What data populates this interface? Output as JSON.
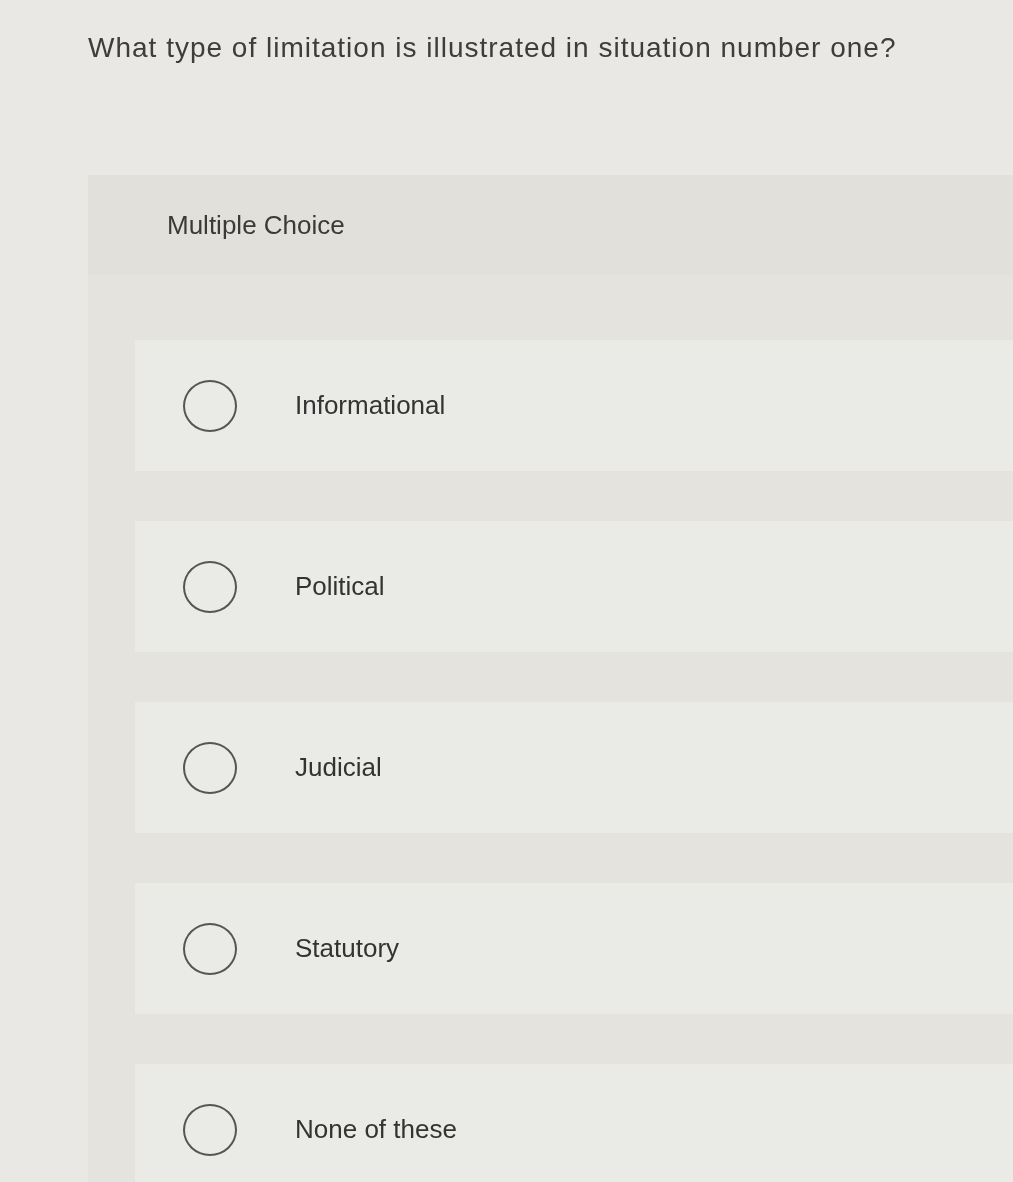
{
  "question": {
    "text": "What type of limitation is illustrated in situation number one?"
  },
  "answer_panel": {
    "heading": "Multiple Choice",
    "options": [
      {
        "label": "Informational",
        "selected": false
      },
      {
        "label": "Political",
        "selected": false
      },
      {
        "label": "Judicial",
        "selected": false
      },
      {
        "label": "Statutory",
        "selected": false
      },
      {
        "label": "None of these",
        "selected": false
      }
    ]
  }
}
